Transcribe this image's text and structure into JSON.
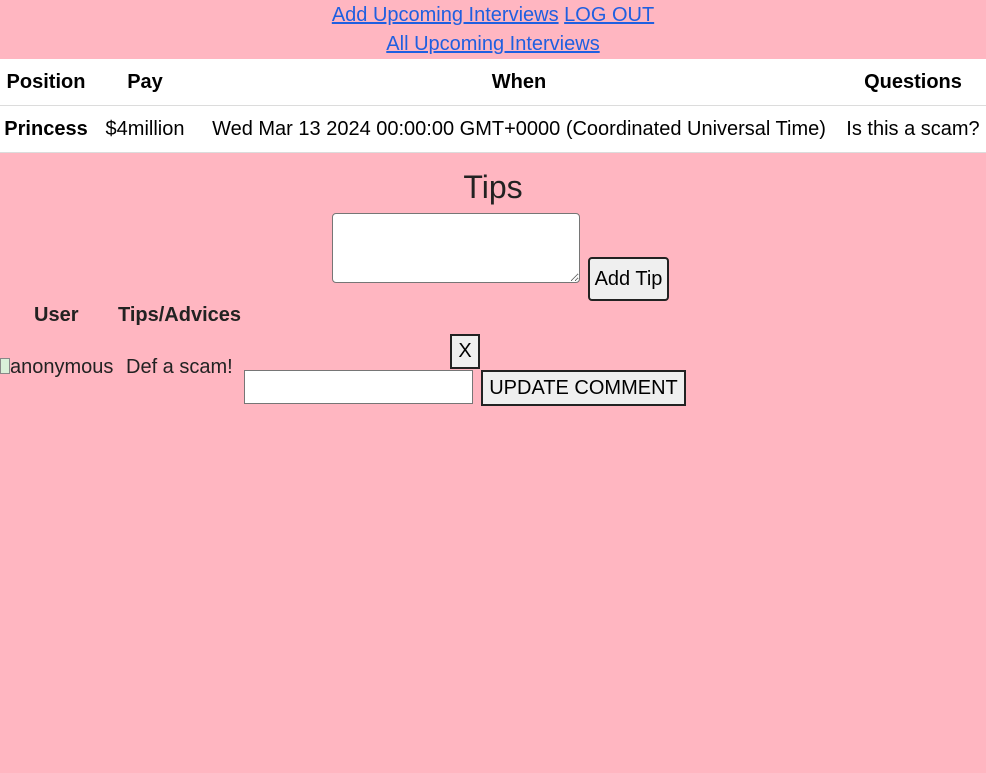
{
  "nav": {
    "add_interviews_link": "Add Upcoming Interviews",
    "logout_link": "LOG OUT",
    "all_interviews_link": "All Upcoming Interviews"
  },
  "interviews_table": {
    "headers": {
      "position": "Position",
      "pay": "Pay",
      "when": "When",
      "questions": "Questions"
    },
    "rows": [
      {
        "position": "Princess",
        "pay": "$4million",
        "when": "Wed Mar 13 2024 00:00:00 GMT+0000 (Coordinated Universal Time)",
        "questions": "Is this a scam?"
      }
    ]
  },
  "tips": {
    "title": "Tips",
    "textarea_value": "",
    "add_button": "Add Tip",
    "headers": {
      "user": "User",
      "tips": "Tips/Advices"
    },
    "items": [
      {
        "user_image_alt": "anonymous",
        "text": "Def a scam!",
        "delete_button": "X",
        "comment_value": "",
        "update_button": "UPDATE COMMENT"
      }
    ]
  },
  "colors": {
    "background": "#ffb6c1",
    "link": "#1f5fe0",
    "table_bg": "#ffffff"
  }
}
